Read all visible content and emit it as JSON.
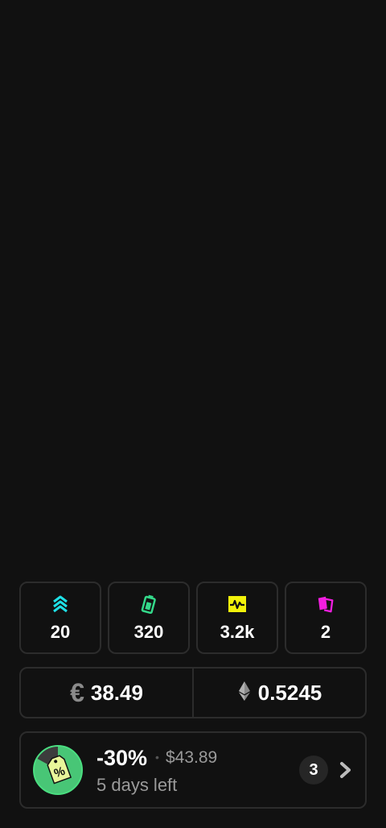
{
  "stats": [
    {
      "name": "boosts",
      "icon": "chevrons-up-icon",
      "color": "#1ee0e6",
      "value": "20"
    },
    {
      "name": "battery",
      "icon": "battery-icon",
      "color": "#34d98a",
      "value": "320"
    },
    {
      "name": "activity",
      "icon": "pulse-icon",
      "color": "#f2f20a",
      "value": "3.2k"
    },
    {
      "name": "cards",
      "icon": "cards-icon",
      "color": "#f21ee0",
      "value": "2"
    }
  ],
  "wallet": {
    "euro_icon": "euro-icon",
    "euro_amount": "38.49",
    "eth_icon": "ethereum-icon",
    "eth_amount": "0.5245"
  },
  "promo": {
    "icon": "discount-tag-icon",
    "discount": "-30%",
    "price": "$43.89",
    "days_left": "5 days left",
    "count": "3",
    "progress": 0.83,
    "accent": "#4ade80"
  }
}
